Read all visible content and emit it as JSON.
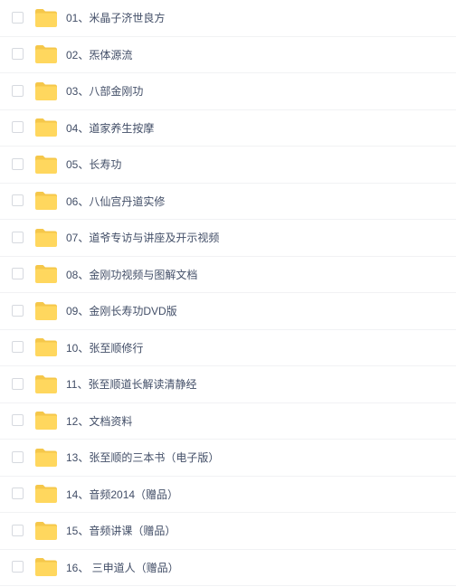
{
  "file_list": {
    "items": [
      {
        "name": "01、米晶子济世良方",
        "icon": "folder-icon"
      },
      {
        "name": "02、炁体源流",
        "icon": "folder-icon"
      },
      {
        "name": "03、八部金刚功",
        "icon": "folder-icon"
      },
      {
        "name": "04、道家养生按摩",
        "icon": "folder-icon"
      },
      {
        "name": "05、长寿功",
        "icon": "folder-icon"
      },
      {
        "name": "06、八仙宫丹道实修",
        "icon": "folder-icon"
      },
      {
        "name": "07、道爷专访与讲座及开示视频",
        "icon": "folder-icon"
      },
      {
        "name": "08、金刚功视频与图解文档",
        "icon": "folder-icon"
      },
      {
        "name": "09、金刚长寿功DVD版",
        "icon": "folder-icon"
      },
      {
        "name": "10、张至顺修行",
        "icon": "folder-icon"
      },
      {
        "name": "11、张至顺道长解读清静经",
        "icon": "folder-icon"
      },
      {
        "name": "12、文档资料",
        "icon": "folder-icon"
      },
      {
        "name": "13、张至顺的三本书（电子版）",
        "icon": "folder-icon"
      },
      {
        "name": "14、音频2014（赠品）",
        "icon": "folder-icon"
      },
      {
        "name": "15、音频讲课（赠品）",
        "icon": "folder-icon"
      },
      {
        "name": "16、 三申道人（赠品）",
        "icon": "folder-icon"
      }
    ]
  },
  "colors": {
    "folder_back": "#f5c74a",
    "folder_front": "#ffd75e",
    "text": "#424e67",
    "checkbox_border": "#d6d9df",
    "divider": "#f1f2f4"
  }
}
